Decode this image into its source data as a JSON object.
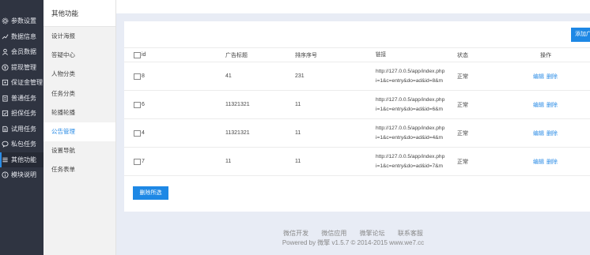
{
  "sidebar": {
    "items": [
      {
        "label": "参数设置",
        "icon": "gear-icon"
      },
      {
        "label": "数据信息",
        "icon": "chart-line-icon"
      },
      {
        "label": "会员数据",
        "icon": "user-icon"
      },
      {
        "label": "提现管理",
        "icon": "yen-icon"
      },
      {
        "label": "保证金管理",
        "icon": "wallet-icon"
      },
      {
        "label": "普通任务",
        "icon": "clipboard-icon"
      },
      {
        "label": "担保任务",
        "icon": "shield-icon"
      },
      {
        "label": "试用任务",
        "icon": "document-icon"
      },
      {
        "label": "私包任务",
        "icon": "chat-icon"
      },
      {
        "label": "其他功能",
        "icon": "list-icon"
      },
      {
        "label": "模块说明",
        "icon": "info-icon"
      }
    ]
  },
  "submenu": {
    "title": "其他功能",
    "items": [
      {
        "label": "设计海报"
      },
      {
        "label": "答疑中心"
      },
      {
        "label": "人物分类"
      },
      {
        "label": "任务分类"
      },
      {
        "label": "轮播轮播"
      },
      {
        "label": "公告管理"
      },
      {
        "label": "设置导航"
      },
      {
        "label": "任务表单"
      }
    ]
  },
  "toolbar": {
    "add_label": "添加广告",
    "delete_selected_label": "删除所选"
  },
  "table": {
    "headers": {
      "id": "id",
      "title": "广告标题",
      "sort": "排序序号",
      "link": "链接",
      "status": "状态",
      "op": "操作"
    },
    "rows": [
      {
        "id": "8",
        "title": "41",
        "sort": "231",
        "link1": "http://127.0.0.5/app/index.php",
        "link2": "i=1&c=entry&do=ad&id=8&m",
        "status": "正常",
        "edit": "编辑",
        "delete": "删除"
      },
      {
        "id": "6",
        "title": "11321321",
        "sort": "11",
        "link1": "http://127.0.0.5/app/index.php",
        "link2": "i=1&c=entry&do=ad&id=6&m",
        "status": "正常",
        "edit": "编辑",
        "delete": "删除"
      },
      {
        "id": "4",
        "title": "11321321",
        "sort": "11",
        "link1": "http://127.0.0.5/app/index.php",
        "link2": "i=1&c=entry&do=ad&id=4&m",
        "status": "正常",
        "edit": "编辑",
        "delete": "删除"
      },
      {
        "id": "7",
        "title": "11",
        "sort": "11",
        "link1": "http://127.0.0.5/app/index.php",
        "link2": "i=1&c=entry&do=ad&id=7&m",
        "status": "正常",
        "edit": "编辑",
        "delete": "删除"
      }
    ]
  },
  "footer": {
    "links": [
      "微信开发",
      "微信应用",
      "微擎论坛",
      "联系客服"
    ],
    "copyright": "Powered by 微擎 v1.5.7 © 2014-2015 www.we7.cc"
  },
  "colors": {
    "accent": "#1e88e5",
    "sidebar_bg": "#2f3441",
    "page_bg": "#e8ecf5"
  }
}
